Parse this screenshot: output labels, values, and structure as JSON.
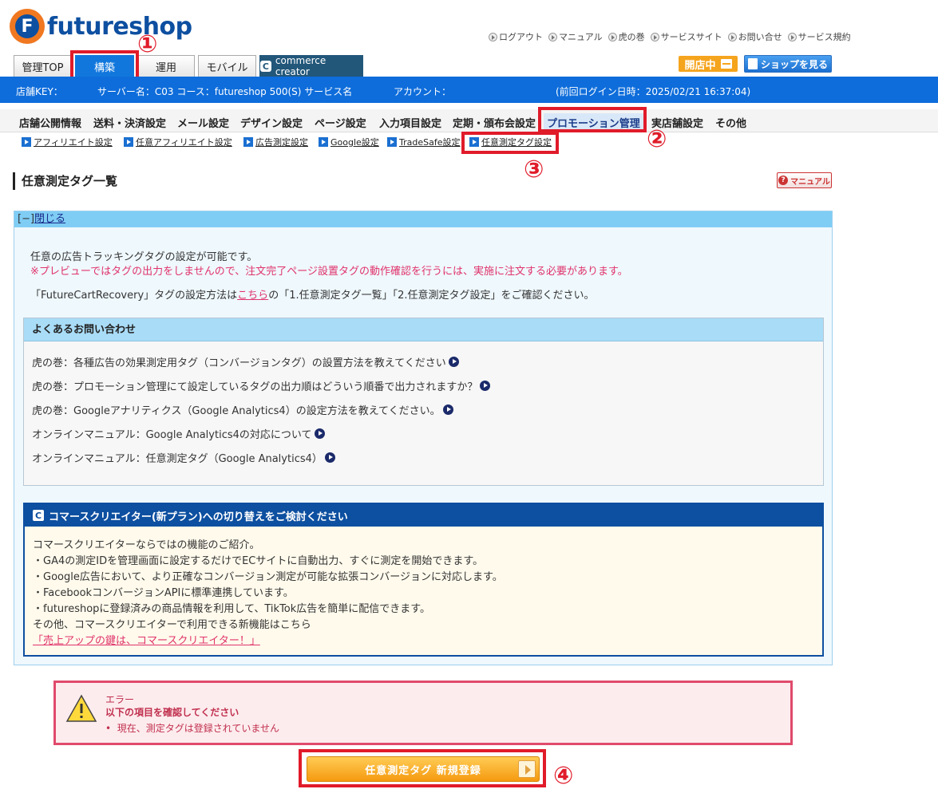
{
  "brand": {
    "name": "futureshop",
    "mark": "F"
  },
  "top_links": [
    "ログアウト",
    "マニュアル",
    "虎の巻",
    "サービスサイト",
    "お問い合せ",
    "サービス規約"
  ],
  "tabs": [
    "管理TOP",
    "構築",
    "運用",
    "モバイル",
    "commerce creator"
  ],
  "header_buttons": {
    "open": "開店中",
    "shop": "ショップを見る"
  },
  "info_bar": {
    "store_key": "店舗KEY：",
    "server": "サーバー名：C03 コース：futureshop 500(S) サービス名",
    "account": "アカウント：",
    "last_login": "(前回ログイン日時：2025/02/21 16:37:04)"
  },
  "menu": [
    "店舗公開情報",
    "送料・決済設定",
    "メール設定",
    "デザイン設定",
    "ページ設定",
    "入力項目設定",
    "定期・頒布会設定",
    "プロモーション管理",
    "実店舗設定",
    "その他"
  ],
  "submenu": [
    "アフィリエイト設定",
    "任意アフィリエイト設定",
    "広告測定設定",
    "Google設定",
    "TradeSafe設定",
    "任意測定タグ設定"
  ],
  "annotations": [
    "①",
    "②",
    "③",
    "④"
  ],
  "page_title": "任意測定タグ一覧",
  "manual_btn": "マニュアル",
  "info": {
    "toggle_prefix": "[−]",
    "toggle": "閉じる",
    "line1": "任意の広告トラッキングタグの設定が可能です。",
    "line2": "※プレビューではタグの出力をしませんので、注文完了ページ設置タグの動作確認を行うには、実施に注文する必要があります。",
    "line3_pre": "「FutureCartRecovery」タグの設定方法は",
    "line3_link": "こちら",
    "line3_post": "の「1.任意測定タグ一覧」「2.任意測定タグ設定」をご確認ください。"
  },
  "faq": {
    "title": "よくあるお問い合わせ",
    "items": [
      "虎の巻：各種広告の効果測定用タグ（コンバージョンタグ）の設置方法を教えてください",
      "虎の巻：プロモーション管理にて設定しているタグの出力順はどういう順番で出力されますか？",
      "虎の巻：Googleアナリティクス（Google Analytics4）の設定方法を教えてください。",
      "オンラインマニュアル：Google Analytics4の対応について",
      "オンラインマニュアル：任意測定タグ（Google Analytics4）"
    ]
  },
  "cc": {
    "icon": "C",
    "title": "コマースクリエイター(新プラン)への切り替えをご検討ください",
    "lines": [
      "コマースクリエイターならではの機能のご紹介。",
      "・GA4の測定IDを管理画面に設定するだけでECサイトに自動出力、すぐに測定を開始できます。",
      "・Google広告において、より正確なコンバージョン測定が可能な拡張コンバージョンに対応します。",
      "・FacebookコンバージョンAPIに標準連携しています。",
      "・futureshopに登録済みの商品情報を利用して、TikTok広告を簡単に配信できます。",
      "その他、コマースクリエイターで利用できる新機能はこちら"
    ],
    "link": "「売上アップの鍵は、コマースクリエイター！」"
  },
  "error": {
    "title": "エラー",
    "subtitle": "以下の項目を確認してください",
    "item": "現在、測定タグは登録されていません"
  },
  "register_btn": "任意測定タグ 新規登録"
}
